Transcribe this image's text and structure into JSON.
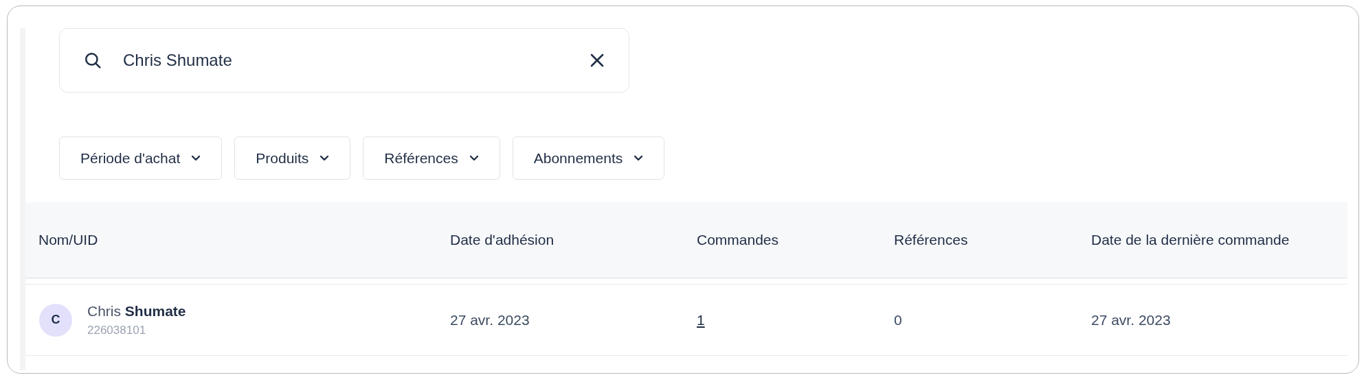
{
  "search": {
    "value": "Chris Shumate"
  },
  "filters": [
    {
      "label": "Période d'achat"
    },
    {
      "label": "Produits"
    },
    {
      "label": "Références"
    },
    {
      "label": "Abonnements"
    }
  ],
  "table": {
    "columns": [
      "Nom/UID",
      "Date d'adhésion",
      "Commandes",
      "Références",
      "Date de la dernière commande"
    ],
    "rows": [
      {
        "initial": "C",
        "name": "Chris **Shumate**",
        "uid": "226038101",
        "joined": "27 avr. 2023",
        "orders": "1",
        "references": "0",
        "last_order": "27 avr. 2023"
      }
    ]
  }
}
